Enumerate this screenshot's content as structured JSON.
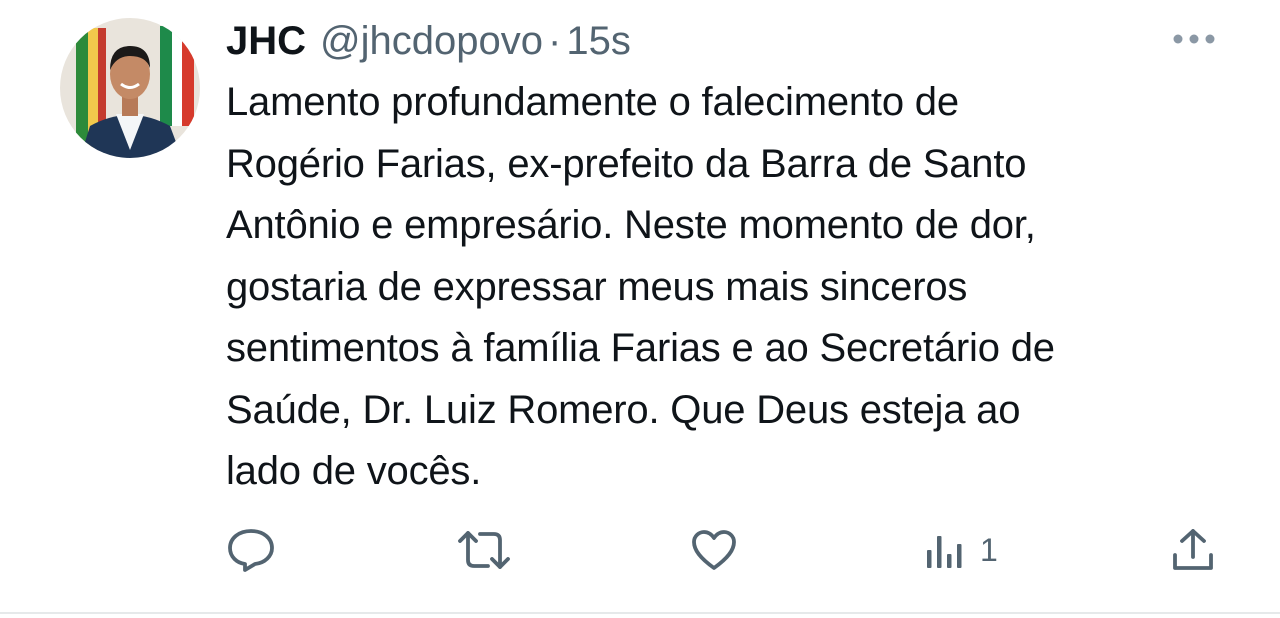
{
  "tweet": {
    "author_name": "JHC",
    "author_handle": "@jhcdopovo",
    "separator": "·",
    "timestamp": "15s",
    "text": "Lamento profundamente o falecimento de\nRogério Farias, ex-prefeito da Barra de Santo\nAntônio e empresário. Neste momento de dor,\ngostaria de expressar meus mais sinceros\nsentimentos à família Farias e ao Secretário de\nSaúde, Dr. Luiz Romero. Que Deus esteja ao\nlado de vocês."
  },
  "actions": {
    "reply_icon": "reply-icon",
    "retweet_icon": "retweet-icon",
    "like_icon": "heart-icon",
    "views_icon": "views-icon",
    "views_count": "1",
    "share_icon": "share-icon",
    "more_icon": "more-dots-icon"
  },
  "colors": {
    "text_primary": "#0f1419",
    "text_secondary": "#536471",
    "divider": "#e6e9ea"
  }
}
